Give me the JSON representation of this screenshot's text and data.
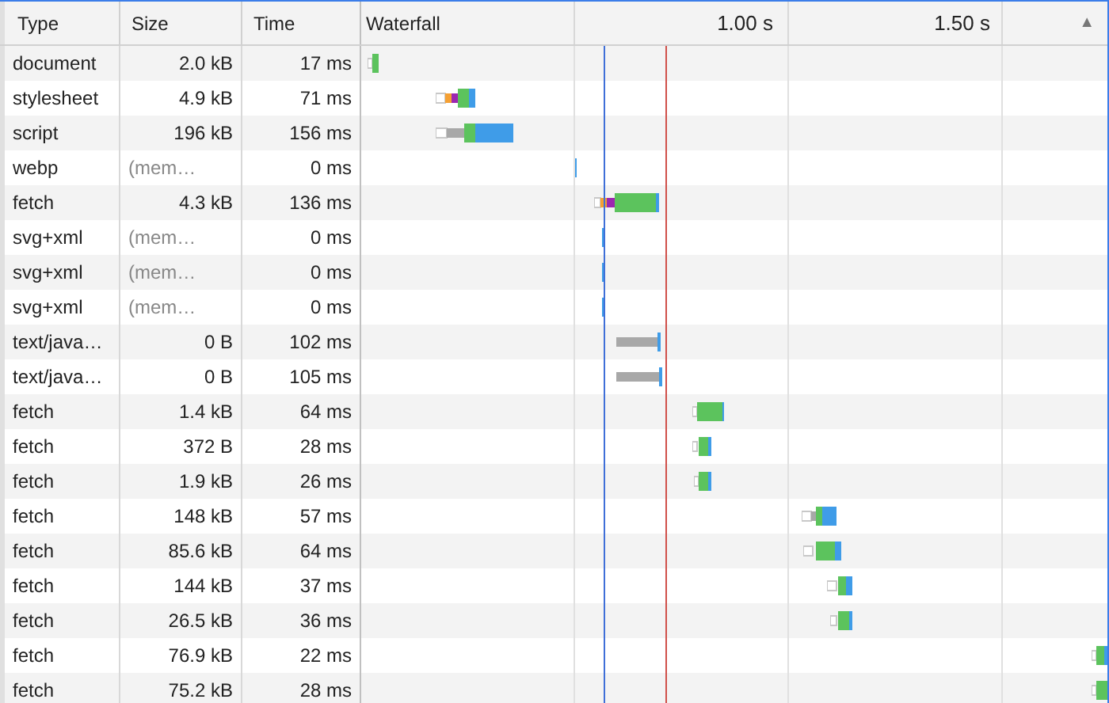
{
  "columns": [
    {
      "label": "Type"
    },
    {
      "label": "Size"
    },
    {
      "label": "Time"
    },
    {
      "label": "Waterfall"
    }
  ],
  "timeline_ticks": [
    "1.00 s",
    "1.50 s"
  ],
  "sort_indicator": "▲",
  "rows": [
    {
      "type": "document",
      "size": "2.0 kB",
      "size_from_memory": false,
      "time": "17 ms"
    },
    {
      "type": "stylesheet",
      "size": "4.9 kB",
      "size_from_memory": false,
      "time": "71 ms"
    },
    {
      "type": "script",
      "size": "196 kB",
      "size_from_memory": false,
      "time": "156 ms"
    },
    {
      "type": "webp",
      "size": "(mem…",
      "size_from_memory": true,
      "time": "0 ms"
    },
    {
      "type": "fetch",
      "size": "4.3 kB",
      "size_from_memory": false,
      "time": "136 ms"
    },
    {
      "type": "svg+xml",
      "size": "(mem…",
      "size_from_memory": true,
      "time": "0 ms"
    },
    {
      "type": "svg+xml",
      "size": "(mem…",
      "size_from_memory": true,
      "time": "0 ms"
    },
    {
      "type": "svg+xml",
      "size": "(mem…",
      "size_from_memory": true,
      "time": "0 ms"
    },
    {
      "type": "text/java…",
      "size": "0 B",
      "size_from_memory": false,
      "time": "102 ms"
    },
    {
      "type": "text/java…",
      "size": "0 B",
      "size_from_memory": false,
      "time": "105 ms"
    },
    {
      "type": "fetch",
      "size": "1.4 kB",
      "size_from_memory": false,
      "time": "64 ms"
    },
    {
      "type": "fetch",
      "size": "372 B",
      "size_from_memory": false,
      "time": "28 ms"
    },
    {
      "type": "fetch",
      "size": "1.9 kB",
      "size_from_memory": false,
      "time": "26 ms"
    },
    {
      "type": "fetch",
      "size": "148 kB",
      "size_from_memory": false,
      "time": "57 ms"
    },
    {
      "type": "fetch",
      "size": "85.6 kB",
      "size_from_memory": false,
      "time": "64 ms"
    },
    {
      "type": "fetch",
      "size": "144 kB",
      "size_from_memory": false,
      "time": "37 ms"
    },
    {
      "type": "fetch",
      "size": "26.5 kB",
      "size_from_memory": false,
      "time": "36 ms"
    },
    {
      "type": "fetch",
      "size": "76.9 kB",
      "size_from_memory": false,
      "time": "22 ms"
    },
    {
      "type": "fetch",
      "size": "75.2 kB",
      "size_from_memory": false,
      "time": "28 ms"
    }
  ]
}
